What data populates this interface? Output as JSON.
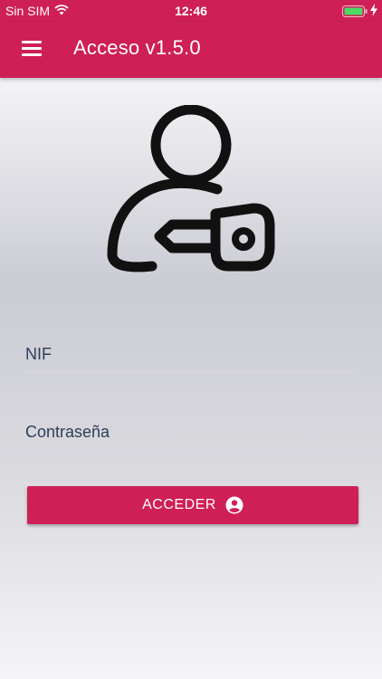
{
  "status_bar": {
    "carrier": "Sin SIM",
    "time": "12:46",
    "icons": [
      "wifi-icon",
      "battery-icon",
      "charging-bolt-icon"
    ]
  },
  "app_bar": {
    "title": "Acceso v1.5.0",
    "menu_icon": "hamburger-menu-icon",
    "color": "#cf1f57"
  },
  "hero": {
    "icon": "user-key-icon"
  },
  "form": {
    "nif_placeholder": "NIF",
    "nif_value": "",
    "password_placeholder": "Contraseña",
    "password_value": ""
  },
  "login_button": {
    "label": "ACCEDER",
    "icon": "account-circle-icon"
  },
  "colors": {
    "accent": "#cf1f57",
    "text": "#2c3e58"
  }
}
